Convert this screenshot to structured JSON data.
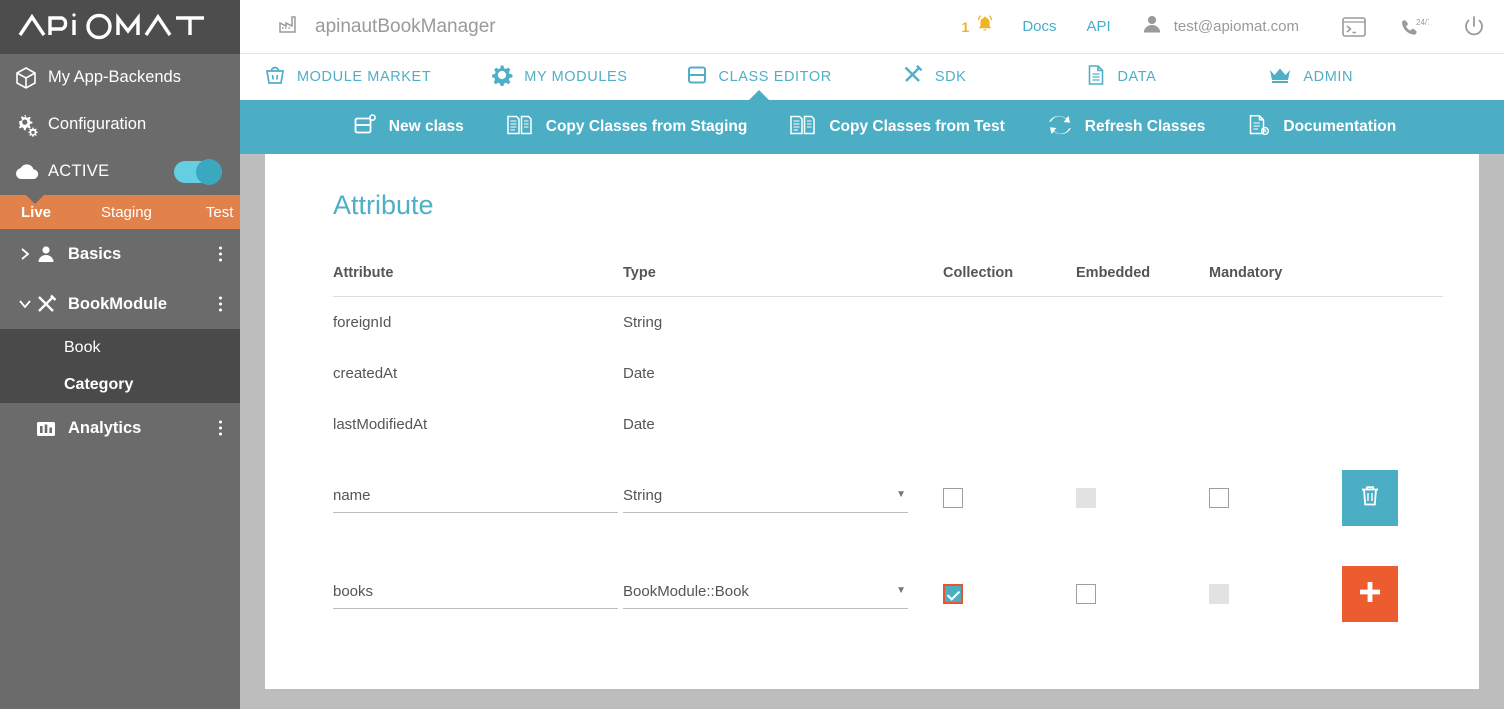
{
  "sidebar": {
    "logo": "APiOMAT",
    "nav": [
      {
        "label": "My App-Backends",
        "icon": "cube-icon"
      },
      {
        "label": "Configuration",
        "icon": "gears-icon"
      }
    ],
    "status": {
      "label": "ACTIVE",
      "icon": "cloud-icon",
      "toggle_on": true
    },
    "environments": [
      {
        "label": "Live",
        "selected": true
      },
      {
        "label": "Staging",
        "selected": false
      },
      {
        "label": "Test",
        "selected": false
      }
    ],
    "tree": [
      {
        "label": "Basics",
        "icon": "user-icon",
        "expanded": false
      },
      {
        "label": "BookModule",
        "icon": "tools-icon",
        "expanded": true
      },
      {
        "label": "Analytics",
        "icon": "chart-icon",
        "expanded": false
      }
    ],
    "tree_children": [
      {
        "label": "Book",
        "selected": false
      },
      {
        "label": "Category",
        "selected": true
      }
    ]
  },
  "header": {
    "app_name": "apinautBookManager",
    "app_icon": "factory-icon",
    "notification_count": "1",
    "notification_icon": "bell-icon",
    "links": [
      {
        "label": "Docs"
      },
      {
        "label": "API"
      }
    ],
    "user_email": "test@apiomat.com",
    "user_icon": "person-icon",
    "icons": [
      {
        "name": "console-icon"
      },
      {
        "name": "support-phone-icon",
        "label": "24/7"
      },
      {
        "name": "power-icon"
      }
    ]
  },
  "navtabs": [
    {
      "label": "MODULE MARKET",
      "icon": "basket-icon",
      "active": false
    },
    {
      "label": "MY MODULES",
      "icon": "gear-icon",
      "active": false
    },
    {
      "label": "CLASS EDITOR",
      "icon": "class-icon",
      "active": true
    },
    {
      "label": "SDK",
      "icon": "tools-icon",
      "active": false
    },
    {
      "label": "DATA",
      "icon": "document-icon",
      "active": false
    },
    {
      "label": "ADMIN",
      "icon": "crown-icon",
      "active": false
    }
  ],
  "toolbar": [
    {
      "label": "New class",
      "icon": "new-class-icon"
    },
    {
      "label": "Copy Classes from Staging",
      "icon": "copy-icon"
    },
    {
      "label": "Copy Classes from Test",
      "icon": "copy-icon"
    },
    {
      "label": "Refresh Classes",
      "icon": "refresh-icon"
    },
    {
      "label": "Documentation",
      "icon": "doc-icon"
    }
  ],
  "main": {
    "title": "Attribute",
    "columns": [
      "Attribute",
      "Type",
      "Collection",
      "Embedded",
      "Mandatory"
    ],
    "static_rows": [
      {
        "attribute": "foreignId",
        "type": "String"
      },
      {
        "attribute": "createdAt",
        "type": "Date"
      },
      {
        "attribute": "lastModifiedAt",
        "type": "Date"
      }
    ],
    "edit_rows": [
      {
        "attribute": "name",
        "attribute_placeholder": "",
        "type": "String",
        "collection": "unchecked",
        "embedded": "disabled",
        "mandatory": "unchecked",
        "action": "delete",
        "action_icon": "trash-icon"
      },
      {
        "attribute": "books",
        "attribute_placeholder": "",
        "type": "BookModule::Book",
        "collection": "checked",
        "embedded": "unchecked",
        "mandatory": "disabled",
        "action": "add",
        "action_icon": "plus-icon"
      }
    ]
  },
  "colors": {
    "teal": "#4caec4",
    "orange": "#ec5c2e",
    "sidebar": "#6b6b6b",
    "env_bar": "#e3814b",
    "amber": "#f0b429"
  }
}
